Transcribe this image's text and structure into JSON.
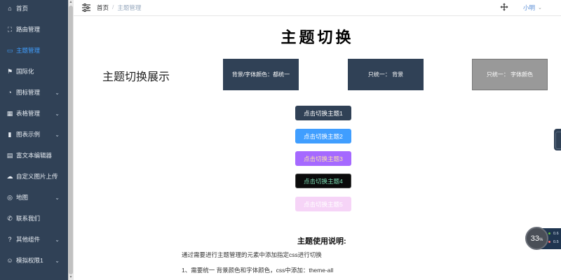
{
  "sidebar": {
    "items": [
      {
        "label": "首页",
        "icon": "home-icon",
        "glyph": "⌂",
        "has_children": false,
        "active": false
      },
      {
        "label": "路由管理",
        "icon": "router-icon",
        "glyph": "⛶",
        "has_children": false,
        "active": false
      },
      {
        "label": "主题管理",
        "icon": "palette-icon",
        "glyph": "▭",
        "has_children": false,
        "active": true
      },
      {
        "label": "国际化",
        "icon": "flag-icon",
        "glyph": "⚑",
        "has_children": false,
        "active": false
      },
      {
        "label": "图标管理",
        "icon": "dashboard-icon",
        "glyph": "◔",
        "has_children": true,
        "active": false
      },
      {
        "label": "表格管理",
        "icon": "table-icon",
        "glyph": "▦",
        "has_children": true,
        "active": false
      },
      {
        "label": "图表示例",
        "icon": "bar-chart-icon",
        "glyph": "▮",
        "has_children": true,
        "active": false
      },
      {
        "label": "富文本编辑器",
        "icon": "document-icon",
        "glyph": "▤",
        "has_children": false,
        "active": false
      },
      {
        "label": "自定义图片上传",
        "icon": "cloud-upload-icon",
        "glyph": "☁",
        "has_children": false,
        "active": false
      },
      {
        "label": "地图",
        "icon": "map-icon",
        "glyph": "◎",
        "has_children": true,
        "active": false
      },
      {
        "label": "联系我们",
        "icon": "phone-icon",
        "glyph": "✆",
        "has_children": false,
        "active": false
      },
      {
        "label": "其他组件",
        "icon": "question-icon",
        "glyph": "?",
        "has_children": true,
        "active": false
      },
      {
        "label": "模拟权限1",
        "icon": "user-icon",
        "glyph": "☺",
        "has_children": true,
        "active": false
      }
    ],
    "chevron": "⌄"
  },
  "navbar": {
    "breadcrumb_home": "首页",
    "breadcrumb_separator": "/",
    "breadcrumb_current": "主题管理",
    "user_name": "小明",
    "user_chevron": "⌄"
  },
  "main": {
    "title": "主题切换",
    "showcase_label": "主题切换展示",
    "demo_boxes": [
      "背景/字体颜色：都统一",
      "只统一：  背景",
      "只统一：  字体颜色"
    ],
    "theme_buttons": [
      "点击切换主题1",
      "点击切换主题2",
      "点击切换主题3",
      "点击切换主题4",
      "点击切换主题5"
    ],
    "usage_title": "主题使用说明:",
    "usage_lines": [
      "通过需要进行主题管理的元素中添加指定css进行切换",
      "1、需要统一 背景颜色和字体颜色，css中添加：theme-all"
    ]
  },
  "widget": {
    "percent": "33",
    "percent_unit": "%",
    "speed_up": "0.6",
    "speed_down": "0.5"
  },
  "colors": {
    "sidebar_bg": "#304156",
    "accent": "#409eff",
    "theme1": "#304156",
    "theme2": "#409eff",
    "theme3": "#a569ff",
    "theme4": "#0b0b0b",
    "theme5": "#f6d4f7"
  }
}
